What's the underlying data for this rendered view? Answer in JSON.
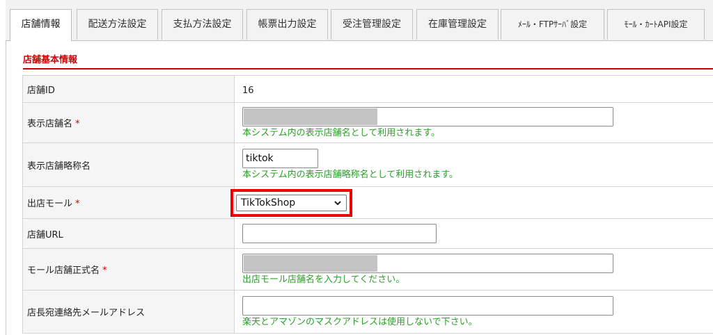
{
  "tabs": [
    {
      "label": "店舗情報"
    },
    {
      "label": "配送方法設定"
    },
    {
      "label": "支払方法設定"
    },
    {
      "label": "帳票出力設定"
    },
    {
      "label": "受注管理設定"
    },
    {
      "label": "在庫管理設定"
    },
    {
      "label": "ﾒｰﾙ・FTPｻｰﾊﾞ設定"
    },
    {
      "label": "ﾓｰﾙ・ｶｰﾄAPI設定"
    }
  ],
  "section_title": "店舗基本情報",
  "required_mark": "*",
  "rows": {
    "shop_id": {
      "label": "店舗ID",
      "value": "16"
    },
    "display_name": {
      "label": "表示店舗名",
      "hint": "本システム内の表示店舗名として利用されます。"
    },
    "display_short": {
      "label": "表示店舗略称名",
      "value": "tiktok",
      "hint": "本システム内の表示店舗略称名として利用されます。"
    },
    "mall": {
      "label": "出店モール",
      "selected": "TikTokShop"
    },
    "shop_url": {
      "label": "店舗URL",
      "value": ""
    },
    "mall_official_name": {
      "label": "モール店舗正式名",
      "hint": "出店モール店舗名を入力してください。"
    },
    "manager_email": {
      "label": "店長宛連絡先メールアドレス",
      "value": "",
      "hint": "楽天とアマゾンのマスクアドレスは使用しないで下さい。"
    }
  },
  "colors": {
    "accent_red": "#cc0000",
    "hint_green": "#2aa025",
    "highlight_red": "#ee0000"
  }
}
